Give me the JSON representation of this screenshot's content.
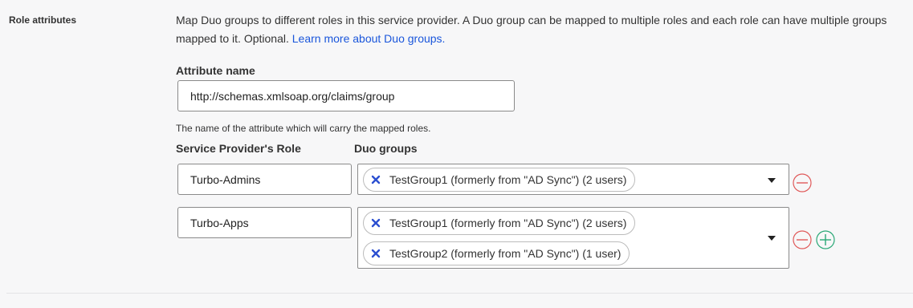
{
  "section": {
    "label": "Role attributes",
    "description": "Map Duo groups to different roles in this service provider. A Duo group can be mapped to multiple roles and each role can have multiple groups mapped to it. Optional.",
    "learn_more_link": "Learn more about Duo groups."
  },
  "attribute": {
    "label": "Attribute name",
    "value": "http://schemas.xmlsoap.org/claims/group",
    "hint": "The name of the attribute which will carry the mapped roles."
  },
  "columns": {
    "role": "Service Provider's Role",
    "groups": "Duo groups"
  },
  "rows": [
    {
      "role": "Turbo-Admins",
      "groups": [
        "TestGroup1 (formerly from \"AD Sync\") (2 users)"
      ]
    },
    {
      "role": "Turbo-Apps",
      "groups": [
        "TestGroup1 (formerly from \"AD Sync\") (2 users)",
        "TestGroup2 (formerly from \"AD Sync\") (1 user)"
      ]
    }
  ],
  "colors": {
    "link": "#1a56db",
    "remove": "#e05a5a",
    "add": "#2aa876",
    "chip_x": "#2b4fd1"
  },
  "icons": {
    "chip_remove": "x-icon",
    "dropdown": "caret-down-icon",
    "remove_row": "minus-circle-icon",
    "add_row": "plus-circle-icon"
  }
}
